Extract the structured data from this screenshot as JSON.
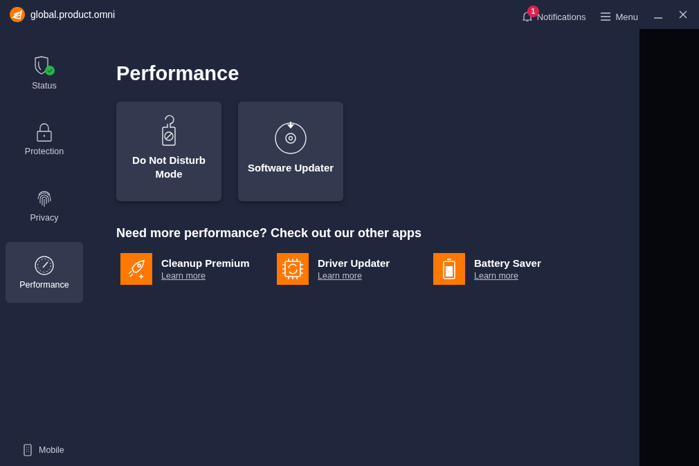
{
  "window": {
    "title": "global.product.omni",
    "notifications": {
      "label": "Notifications",
      "count": "1"
    },
    "menu": {
      "label": "Menu"
    }
  },
  "sidebar": {
    "items": [
      {
        "label": "Status",
        "selected": false
      },
      {
        "label": "Protection",
        "selected": false
      },
      {
        "label": "Privacy",
        "selected": false
      },
      {
        "label": "Performance",
        "selected": true
      }
    ],
    "footer": {
      "label": "Mobile"
    }
  },
  "page": {
    "title": "Performance",
    "tiles": [
      {
        "label": "Do Not Disturb Mode"
      },
      {
        "label": "Software Updater"
      }
    ],
    "apps_heading": "Need more performance? Check out our other apps",
    "apps": [
      {
        "name": "Cleanup Premium",
        "link": "Learn more"
      },
      {
        "name": "Driver Updater",
        "link": "Learn more"
      },
      {
        "name": "Battery Saver",
        "link": "Learn more"
      }
    ]
  }
}
